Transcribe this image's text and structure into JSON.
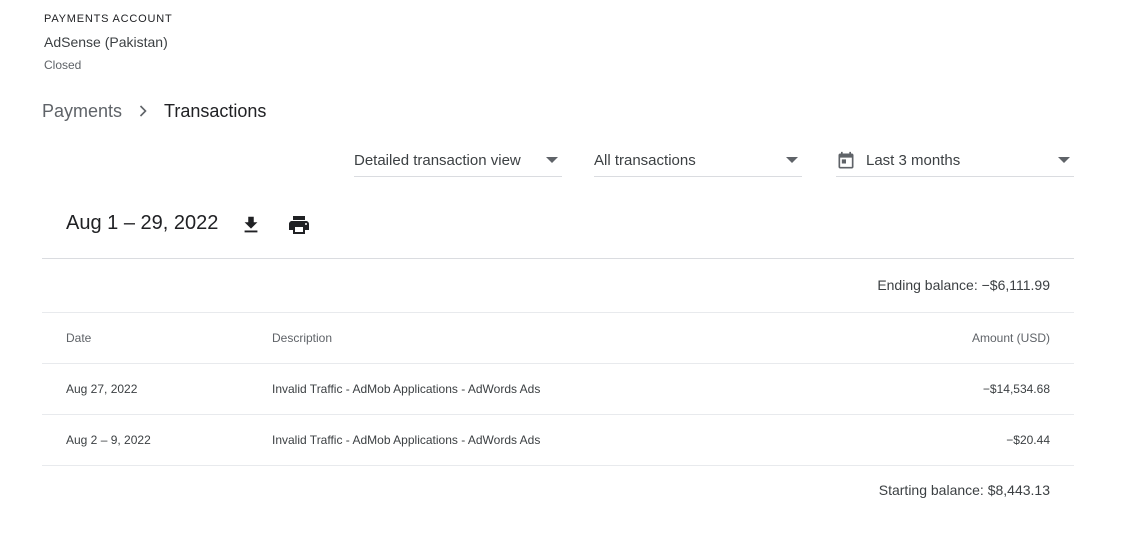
{
  "account": {
    "label": "PAYMENTS ACCOUNT",
    "name": "AdSense (Pakistan)",
    "status": "Closed"
  },
  "breadcrumb": {
    "parent": "Payments",
    "current": "Transactions"
  },
  "filters": {
    "view": "Detailed transaction view",
    "type": "All transactions",
    "range": "Last 3 months"
  },
  "period": {
    "title": "Aug 1 – 29, 2022"
  },
  "ending_balance": "Ending balance: −$6,111.99",
  "table": {
    "headers": {
      "date": "Date",
      "description": "Description",
      "amount": "Amount (USD)"
    },
    "rows": [
      {
        "date": "Aug 27, 2022",
        "description": "Invalid Traffic - AdMob Applications - AdWords Ads",
        "amount": "−$14,534.68"
      },
      {
        "date": "Aug 2 – 9, 2022",
        "description": "Invalid Traffic - AdMob Applications - AdWords Ads",
        "amount": "−$20.44"
      }
    ]
  },
  "starting_balance": "Starting balance: $8,443.13",
  "icons": {
    "breadcrumb_separator": "chevron-right-icon",
    "calendar": "calendar-icon",
    "download": "download-icon",
    "print": "print-icon",
    "dropdown": "caret-down-icon"
  }
}
